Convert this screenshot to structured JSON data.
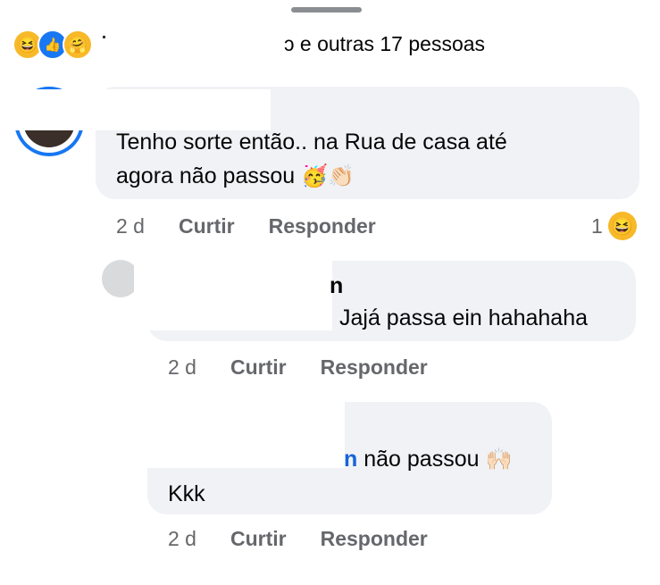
{
  "reaction_bar": {
    "icons": [
      "haha-icon",
      "like-icon",
      "care-icon"
    ],
    "summary": "e outras 17 pessoas",
    "summary_prefix": "ɔ"
  },
  "comments": [
    {
      "text_line1": "Tenho sorte então.. na Rua de casa até",
      "text_line2": "agora não passou",
      "emojis": "🥳👏🏻",
      "time": "2 d",
      "like_label": "Curtir",
      "reply_label": "Responder",
      "reaction_count": "1",
      "reaction_icon": "😆"
    },
    {
      "author_fragment": "n",
      "text": "Jajá passa ein hahahaha",
      "time": "2 d",
      "like_label": "Curtir",
      "reply_label": "Responder"
    },
    {
      "mention_fragment": "n",
      "text_line1": "não passou",
      "emoji": "🙌🏻",
      "text_line2": "Kkk",
      "time": "2 d",
      "like_label": "Curtir",
      "reply_label": "Responder"
    }
  ]
}
